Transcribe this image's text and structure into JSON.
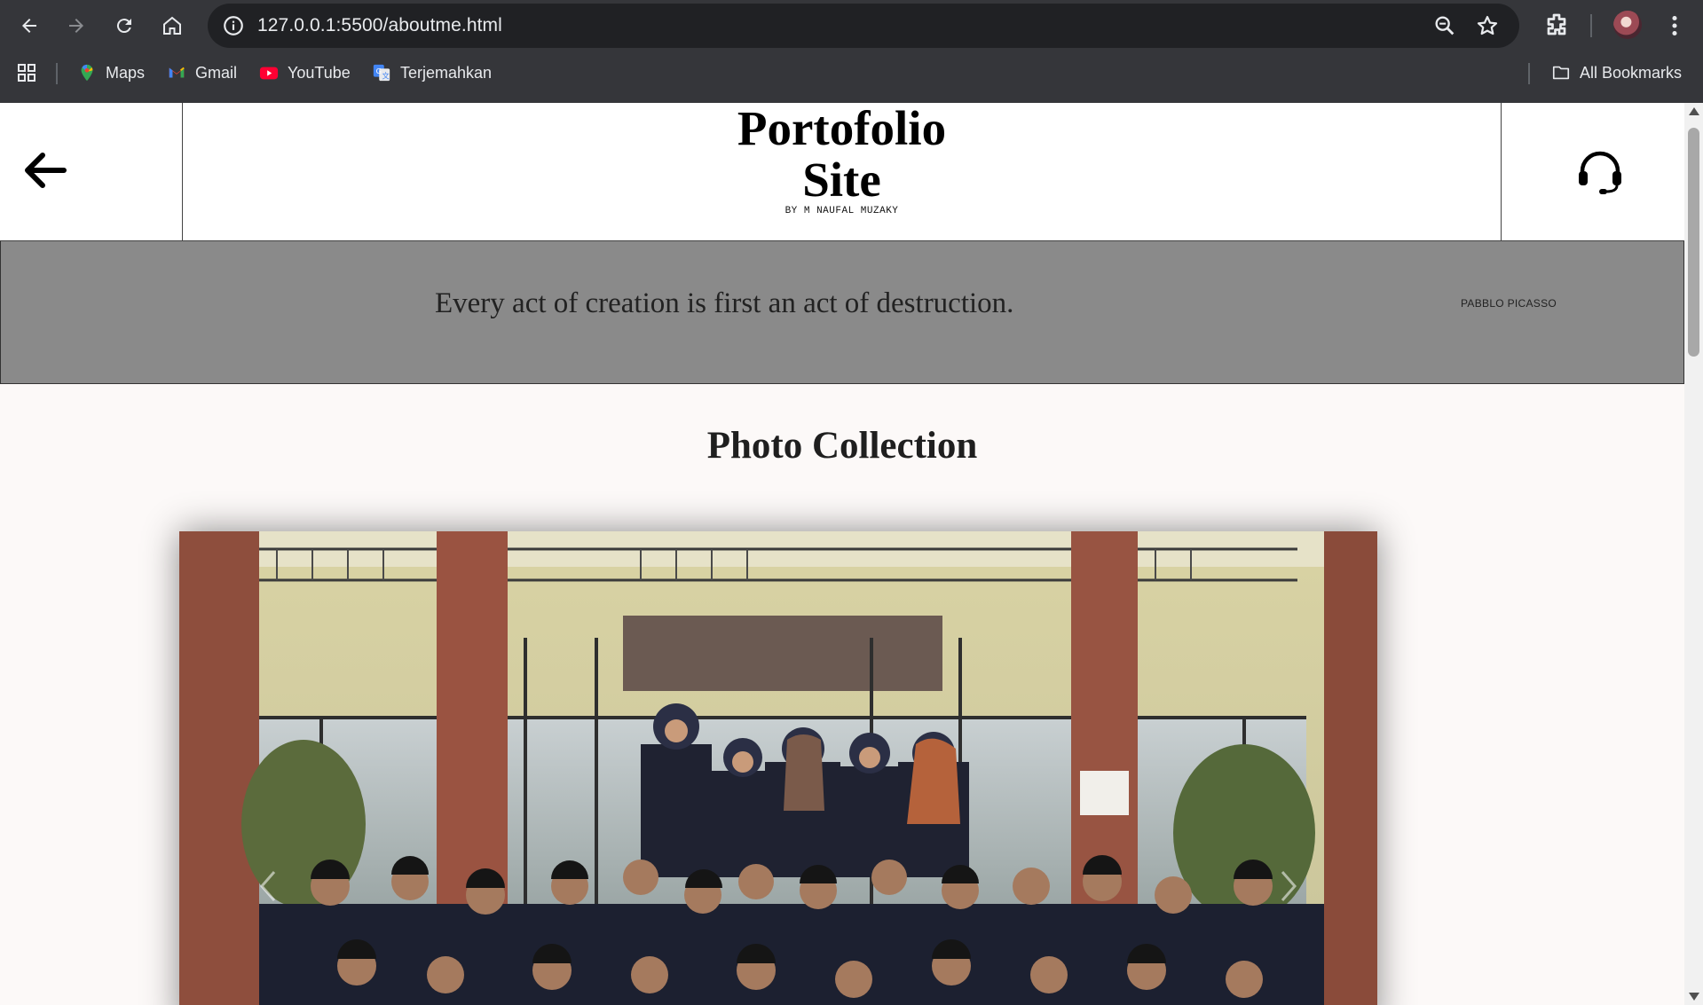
{
  "browser": {
    "url": "127.0.0.1:5500/aboutme.html",
    "bookmarks": [
      {
        "label": "Maps",
        "icon": "maps-icon"
      },
      {
        "label": "Gmail",
        "icon": "gmail-icon"
      },
      {
        "label": "YouTube",
        "icon": "youtube-icon"
      },
      {
        "label": "Terjemahkan",
        "icon": "translate-icon"
      }
    ],
    "all_bookmarks": "All Bookmarks"
  },
  "header": {
    "title_line1": "Portofolio",
    "title_line2": "Site",
    "subtitle": "BY M NAUFAL MUZAKY"
  },
  "quote": {
    "text": "Every act of creation is first an act of destruction.",
    "author": "PABBLO PICASSO"
  },
  "gallery": {
    "title": "Photo Collection"
  },
  "colors": {
    "chrome_bg": "#35363a",
    "omnibox_bg": "#202124",
    "quote_band": "#8a8a8a",
    "page_bg": "#fcf9f8"
  }
}
